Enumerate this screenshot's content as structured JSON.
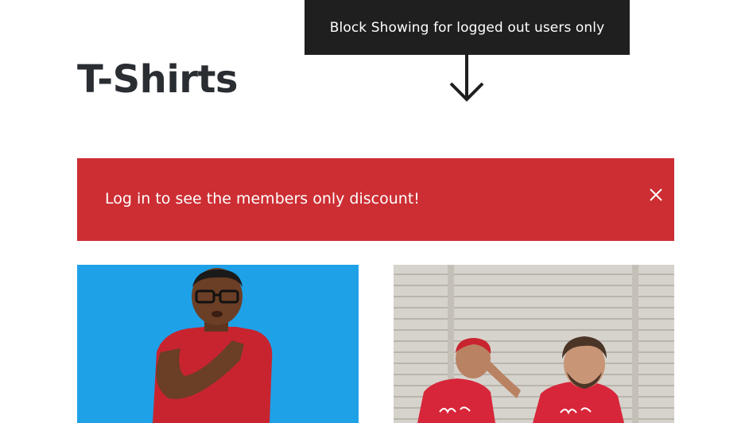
{
  "tooltip": {
    "text": "Block Showing for logged out users only"
  },
  "page": {
    "title": "T-Shirts"
  },
  "notice": {
    "text": "Log in to see the members only discount!",
    "close_icon": "close-icon"
  },
  "products": [
    {
      "image": "man-in-red-tshirt-photo"
    },
    {
      "image": "couple-in-red-tshirts-photo"
    }
  ],
  "colors": {
    "tooltip_bg": "#1f1f1f",
    "notice_bg": "#cc2e33",
    "title": "#2a2e33",
    "product1_bg": "#1fa1e8"
  }
}
